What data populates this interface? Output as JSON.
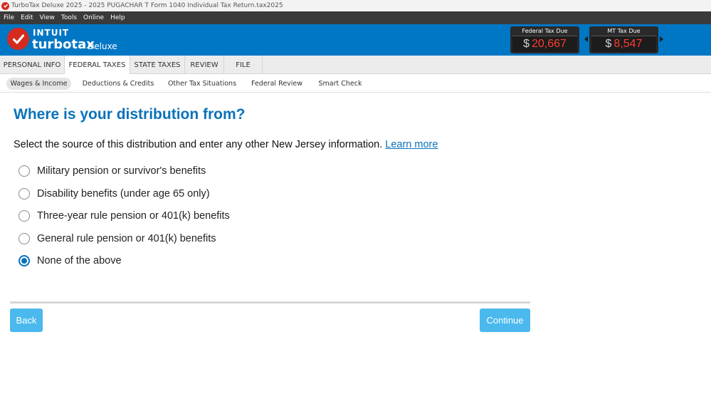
{
  "window": {
    "title": "TurboTax Deluxe 2025 - 2025 PUGACHAR T Form 1040  Individual Tax Return.tax2025"
  },
  "menu": [
    "File",
    "Edit",
    "View",
    "Tools",
    "Online",
    "Help"
  ],
  "brand": {
    "company": "INTUIT",
    "product": "turbotax",
    "edition": "Deluxe",
    "brand_color": "#0077c5",
    "logo_color": "#d52b1e"
  },
  "tax_due": {
    "federal": {
      "label": "Federal Tax Due",
      "currency": "$",
      "amount": "20,667"
    },
    "state": {
      "label": "MT Tax Due",
      "currency": "$",
      "amount": "8,547"
    },
    "amount_color": "#ff3b2f"
  },
  "primary_tabs": [
    {
      "label": "PERSONAL INFO"
    },
    {
      "label": "FEDERAL TAXES",
      "active": true
    },
    {
      "label": "STATE TAXES"
    },
    {
      "label": "REVIEW"
    },
    {
      "label": "FILE"
    }
  ],
  "secondary_tabs": [
    {
      "label": "Wages & Income",
      "active": true
    },
    {
      "label": "Deductions & Credits"
    },
    {
      "label": "Other Tax Situations"
    },
    {
      "label": "Federal Review"
    },
    {
      "label": "Smart Check"
    }
  ],
  "main": {
    "title": "Where is your distribution from?",
    "instruction": "Select the source of this distribution and enter any other New Jersey information.",
    "learn_more": "Learn more",
    "options": [
      {
        "label": "Military pension or survivor's benefits",
        "selected": false
      },
      {
        "label": "Disability benefits (under age 65 only)",
        "selected": false
      },
      {
        "label": "Three-year rule pension or 401(k) benefits",
        "selected": false
      },
      {
        "label": "General rule pension or 401(k) benefits",
        "selected": false
      },
      {
        "label": "None of the above",
        "selected": true
      }
    ],
    "accent_color": "#0a72bb"
  },
  "buttons": {
    "back": "Back",
    "continue": "Continue",
    "color": "#4bb9ee"
  }
}
